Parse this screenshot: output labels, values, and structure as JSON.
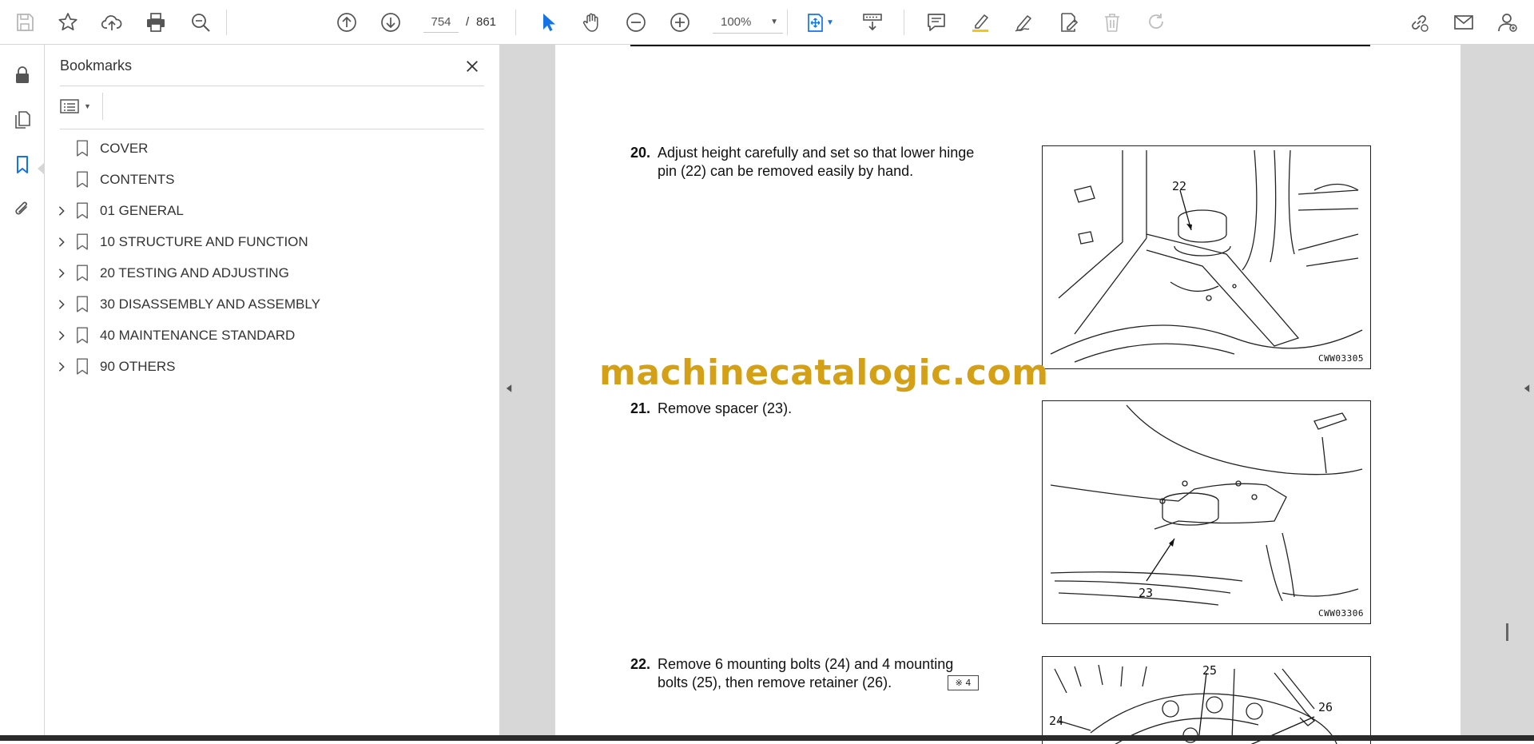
{
  "toolbar": {
    "page_current": "754",
    "page_separator": "/",
    "page_total": "861",
    "zoom": "100%",
    "icons": {
      "save": "save-icon",
      "bookmark_star": "star-icon",
      "upload": "cloud-upload-icon",
      "print": "print-icon",
      "find": "zoom-search-icon",
      "prev_page": "arrow-up-circle-icon",
      "next_page": "arrow-down-circle-icon",
      "select": "cursor-arrow-icon",
      "hand": "hand-icon",
      "zoom_out": "minus-circle-icon",
      "zoom_in": "plus-circle-icon",
      "fit": "fit-page-icon",
      "scroll_mode": "scroll-mode-icon",
      "comment": "comment-icon",
      "highlight": "highlight-pen-icon",
      "draw": "draw-pen-icon",
      "edit": "edit-text-icon",
      "delete": "trash-icon",
      "redo": "redo-icon",
      "share_link": "link-icon",
      "email": "email-icon",
      "account": "account-icon"
    },
    "accent_color": "#1473e6"
  },
  "rail": {
    "icons": [
      "lock-icon",
      "pages-icon",
      "bookmark-icon",
      "attachment-icon"
    ],
    "active_color": "#1473e6"
  },
  "bookmarks": {
    "title": "Bookmarks",
    "items": [
      {
        "label": "COVER",
        "expandable": false
      },
      {
        "label": "CONTENTS",
        "expandable": false
      },
      {
        "label": "01 GENERAL",
        "expandable": true
      },
      {
        "label": "10 STRUCTURE AND FUNCTION",
        "expandable": true
      },
      {
        "label": "20 TESTING AND ADJUSTING",
        "expandable": true
      },
      {
        "label": "30 DISASSEMBLY AND ASSEMBLY",
        "expandable": true
      },
      {
        "label": "40 MAINTENANCE STANDARD",
        "expandable": true
      },
      {
        "label": "90 OTHERS",
        "expandable": true
      }
    ]
  },
  "document": {
    "watermark": "machinecatalogic.com",
    "watermark_color": "#d4a116",
    "steps": [
      {
        "num": "20.",
        "line1": "Adjust height carefully and set so that lower hinge",
        "line2": "pin (22) can be removed easily by hand.",
        "figure_code": "CWW03305",
        "callouts": [
          "22"
        ]
      },
      {
        "num": "21.",
        "line1": "Remove spacer (23).",
        "line2": "",
        "figure_code": "CWW03306",
        "callouts": [
          "23"
        ]
      },
      {
        "num": "22.",
        "line1": "Remove 6 mounting bolts (24) and 4 mounting",
        "line2": "bolts (25), then remove retainer (26).",
        "ref_tag": "※ 4",
        "callouts": [
          "24",
          "25",
          "26"
        ]
      }
    ]
  }
}
